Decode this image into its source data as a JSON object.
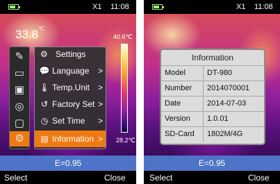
{
  "status": {
    "zoom": "X1",
    "time": "11:08",
    "battery_level": 0.6,
    "battery_color": "#9ff07a"
  },
  "left_screen": {
    "center_temp": "33.8",
    "center_temp_unit": "℃",
    "scale_max": "40.6℃",
    "scale_min": "28.2℃",
    "side_icons": [
      {
        "name": "pencil-icon",
        "glyph": "✎"
      },
      {
        "name": "ruler-icon",
        "glyph": "▭"
      },
      {
        "name": "image-icon",
        "glyph": "▣"
      },
      {
        "name": "palette-icon",
        "glyph": "◎"
      },
      {
        "name": "video-icon",
        "glyph": "▢"
      },
      {
        "name": "settings-gear-icon",
        "glyph": "⚙"
      }
    ],
    "menu": {
      "header": "Settings",
      "header_icon": "gear-icon",
      "items": [
        {
          "label": "Language",
          "icon": "speech-bubble-icon",
          "glyph": "💬"
        },
        {
          "label": "Temp.Unit",
          "icon": "thermometer-icon",
          "glyph": "🌡"
        },
        {
          "label": "Factory Set",
          "icon": "reset-icon",
          "glyph": "↺"
        },
        {
          "label": "Set Time",
          "icon": "clock-icon",
          "glyph": "◷"
        },
        {
          "label": "Information",
          "icon": "document-icon",
          "glyph": "▤"
        }
      ],
      "chevron": ">",
      "selected_index": 4
    },
    "emissivity": "E=0.95",
    "softkeys": {
      "left": "Select",
      "right": "Close"
    }
  },
  "right_screen": {
    "info": {
      "title": "Information",
      "rows": [
        {
          "label": "Model",
          "value": "DT-980"
        },
        {
          "label": "Number",
          "value": "2014070001"
        },
        {
          "label": "Date",
          "value": "2014-07-03"
        },
        {
          "label": "Version",
          "value": "1.0.01"
        },
        {
          "label": "SD-Card",
          "value": "1802M/4G"
        }
      ]
    },
    "emissivity": "E=0.95",
    "softkeys": {
      "left": "Select",
      "right": "Close"
    }
  },
  "colors": {
    "accent_orange": "#f07a12",
    "bottom_band_blue": "#4e74c8"
  }
}
